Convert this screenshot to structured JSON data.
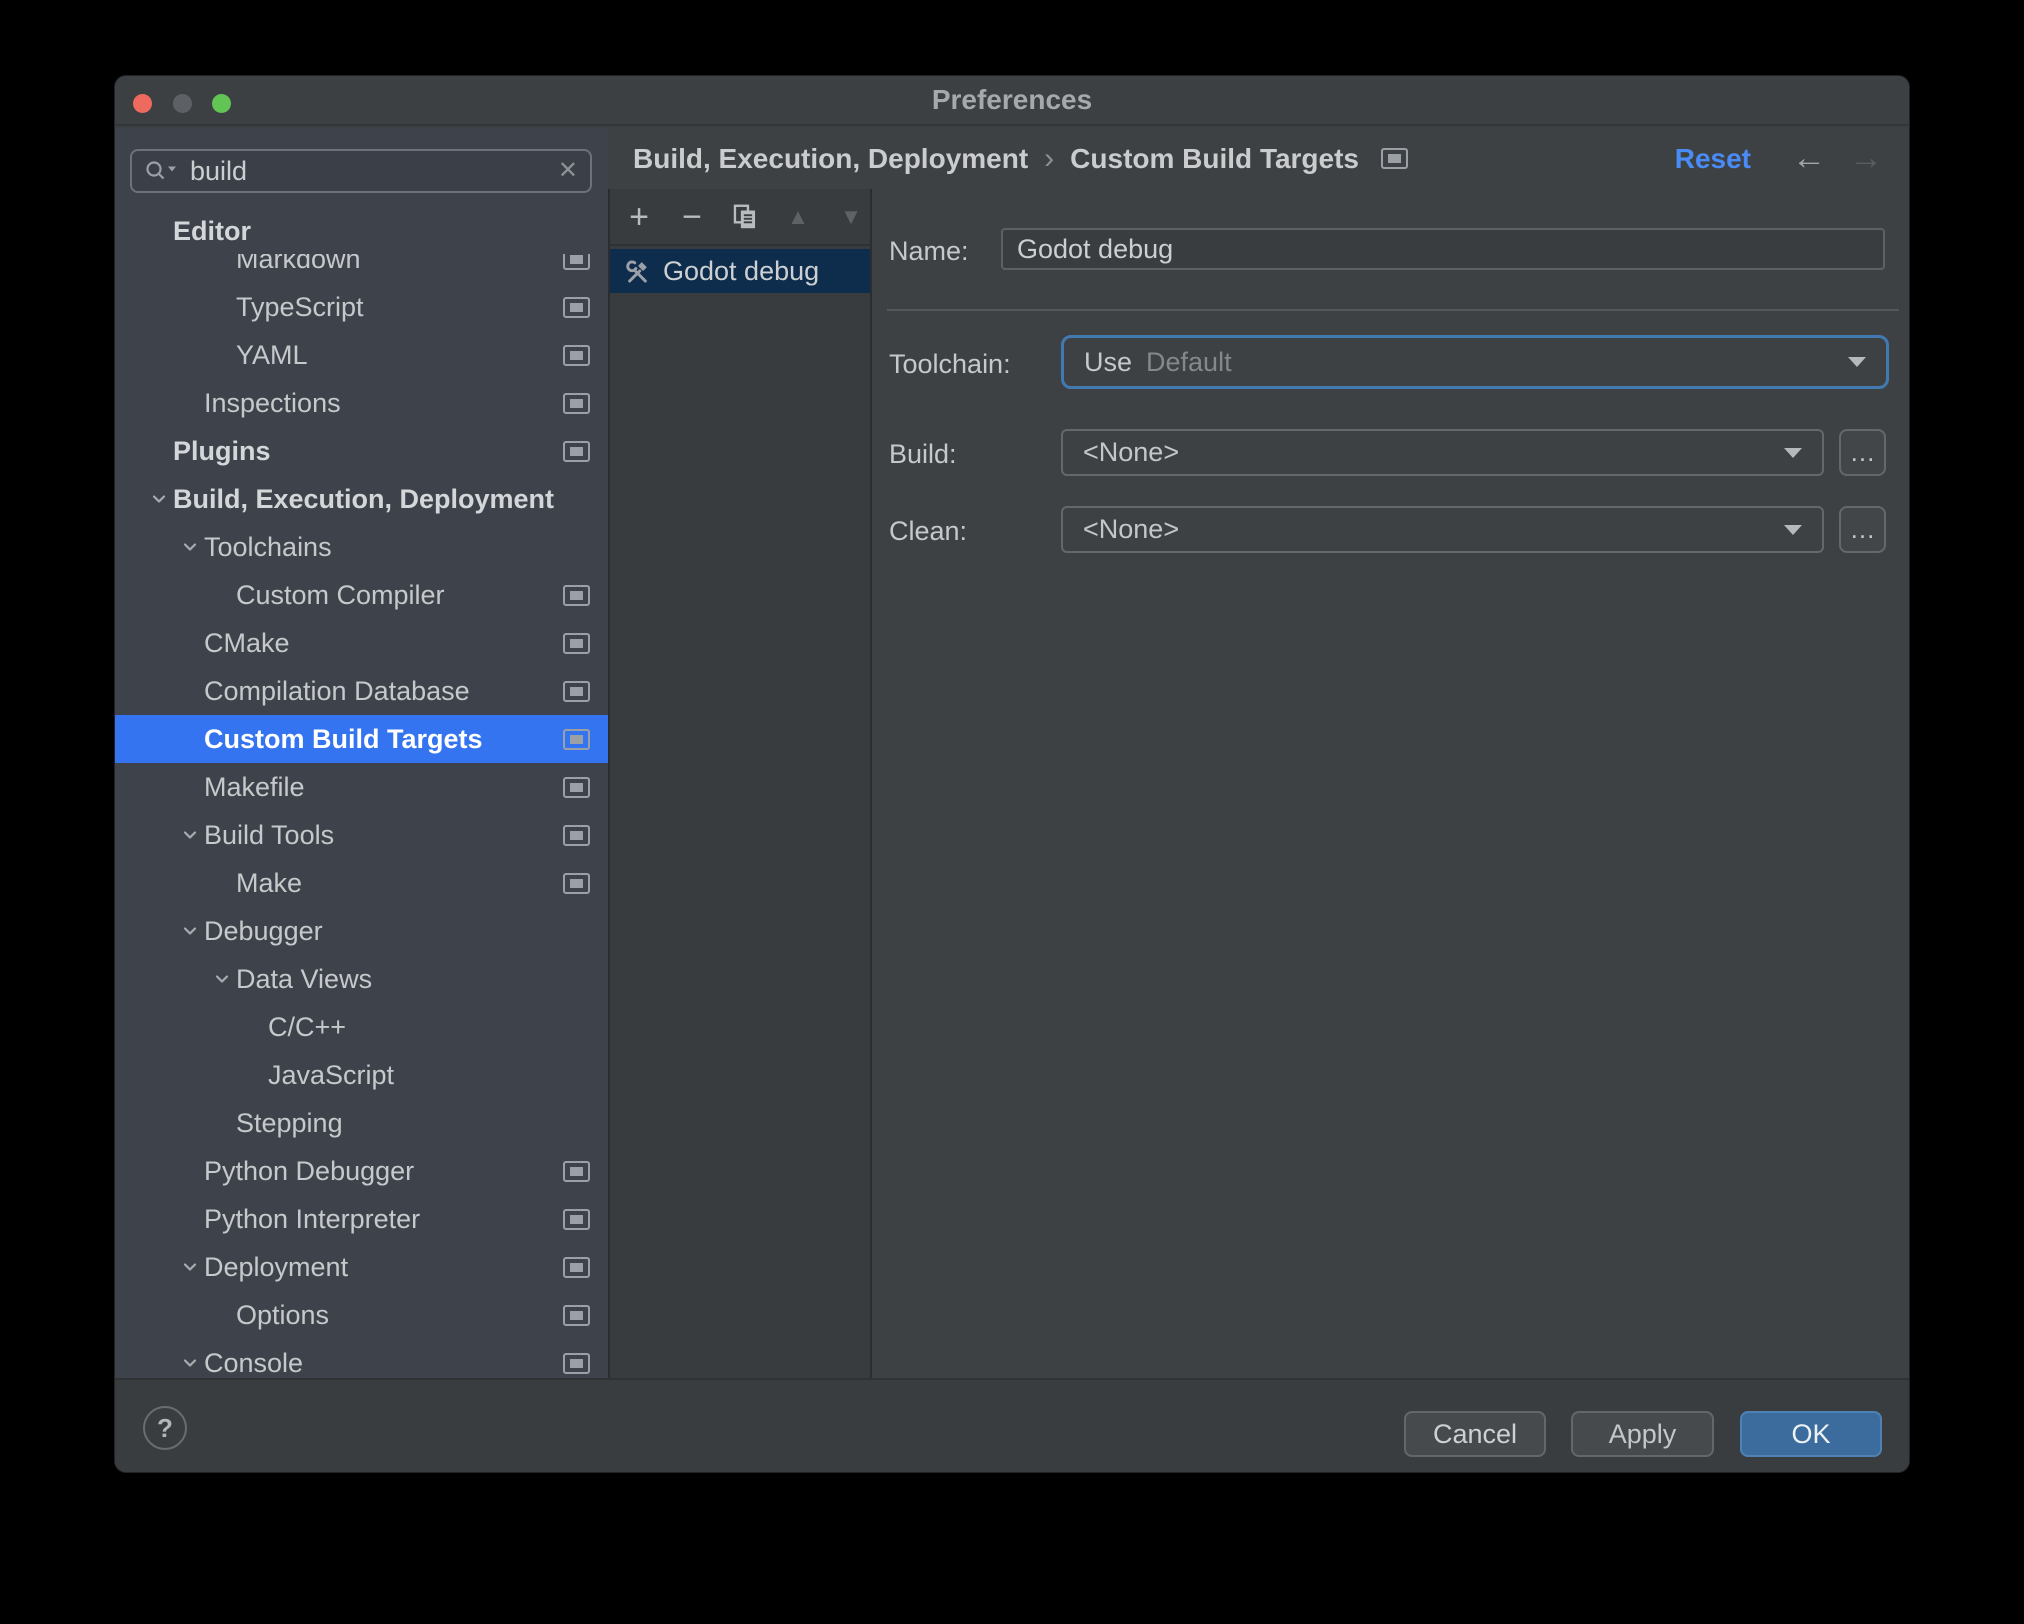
{
  "colors": {
    "window_bg": "#3c4043",
    "sidebar_bg": "#3e434b",
    "panel_bg": "#3d4144",
    "list_bg": "#393c3f",
    "footer_bg": "#3a3d40",
    "accent_blue": "#3574f0",
    "selection_dark": "#0e2c4c",
    "link_blue": "#4a8cf7",
    "ok_blue": "#3c6c9e"
  },
  "window": {
    "title": "Preferences"
  },
  "icons": {
    "clear": "✕",
    "add": "+",
    "remove": "−",
    "move_up": "▲",
    "move_down": "▼",
    "back": "←",
    "forward": "→",
    "help": "?",
    "breadcrumb_sep": "›",
    "more": "…"
  },
  "sidebar": {
    "search": {
      "value": "build"
    },
    "sticky_header": "Editor",
    "items": [
      {
        "label": "Markdown",
        "level": 3,
        "badge": true
      },
      {
        "label": "TypeScript",
        "level": 3,
        "badge": true
      },
      {
        "label": "YAML",
        "level": 3,
        "badge": true
      },
      {
        "label": "Inspections",
        "level": 2,
        "badge": true
      },
      {
        "label": "Plugins",
        "level": 1,
        "bold": true,
        "badge": true
      },
      {
        "label": "Build, Execution, Deployment",
        "level": 1,
        "bold": true,
        "chevron": true
      },
      {
        "label": "Toolchains",
        "level": 2,
        "chevron": true
      },
      {
        "label": "Custom Compiler",
        "level": 3,
        "badge": true
      },
      {
        "label": "CMake",
        "level": 2,
        "badge": true
      },
      {
        "label": "Compilation Database",
        "level": 2,
        "badge": true
      },
      {
        "label": "Custom Build Targets",
        "level": 2,
        "badge": true,
        "selected": true
      },
      {
        "label": "Makefile",
        "level": 2,
        "badge": true
      },
      {
        "label": "Build Tools",
        "level": 2,
        "chevron": true,
        "badge": true
      },
      {
        "label": "Make",
        "level": 3,
        "badge": true
      },
      {
        "label": "Debugger",
        "level": 2,
        "chevron": true
      },
      {
        "label": "Data Views",
        "level": 3,
        "chevron": true
      },
      {
        "label": "C/C++",
        "level": 4
      },
      {
        "label": "JavaScript",
        "level": 4
      },
      {
        "label": "Stepping",
        "level": 3
      },
      {
        "label": "Python Debugger",
        "level": 2,
        "badge": true
      },
      {
        "label": "Python Interpreter",
        "level": 2,
        "badge": true
      },
      {
        "label": "Deployment",
        "level": 2,
        "chevron": true,
        "badge": true
      },
      {
        "label": "Options",
        "level": 3,
        "badge": true
      },
      {
        "label": "Console",
        "level": 2,
        "chevron": true,
        "badge": true
      }
    ]
  },
  "header": {
    "breadcrumb_1": "Build, Execution, Deployment",
    "breadcrumb_2": "Custom Build Targets",
    "reset": "Reset"
  },
  "list": {
    "toolbar_icons": [
      "add",
      "remove",
      "copy",
      "move-up",
      "move-down"
    ],
    "items": [
      {
        "label": "Godot debug",
        "selected": true
      }
    ]
  },
  "form": {
    "name_label": "Name:",
    "name_value": "Godot debug",
    "toolchain_label": "Toolchain:",
    "toolchain_prefix": "Use",
    "toolchain_value": "Default",
    "build_label": "Build:",
    "build_value": "<None>",
    "clean_label": "Clean:",
    "clean_value": "<None>"
  },
  "footer": {
    "cancel": "Cancel",
    "apply": "Apply",
    "ok": "OK"
  }
}
